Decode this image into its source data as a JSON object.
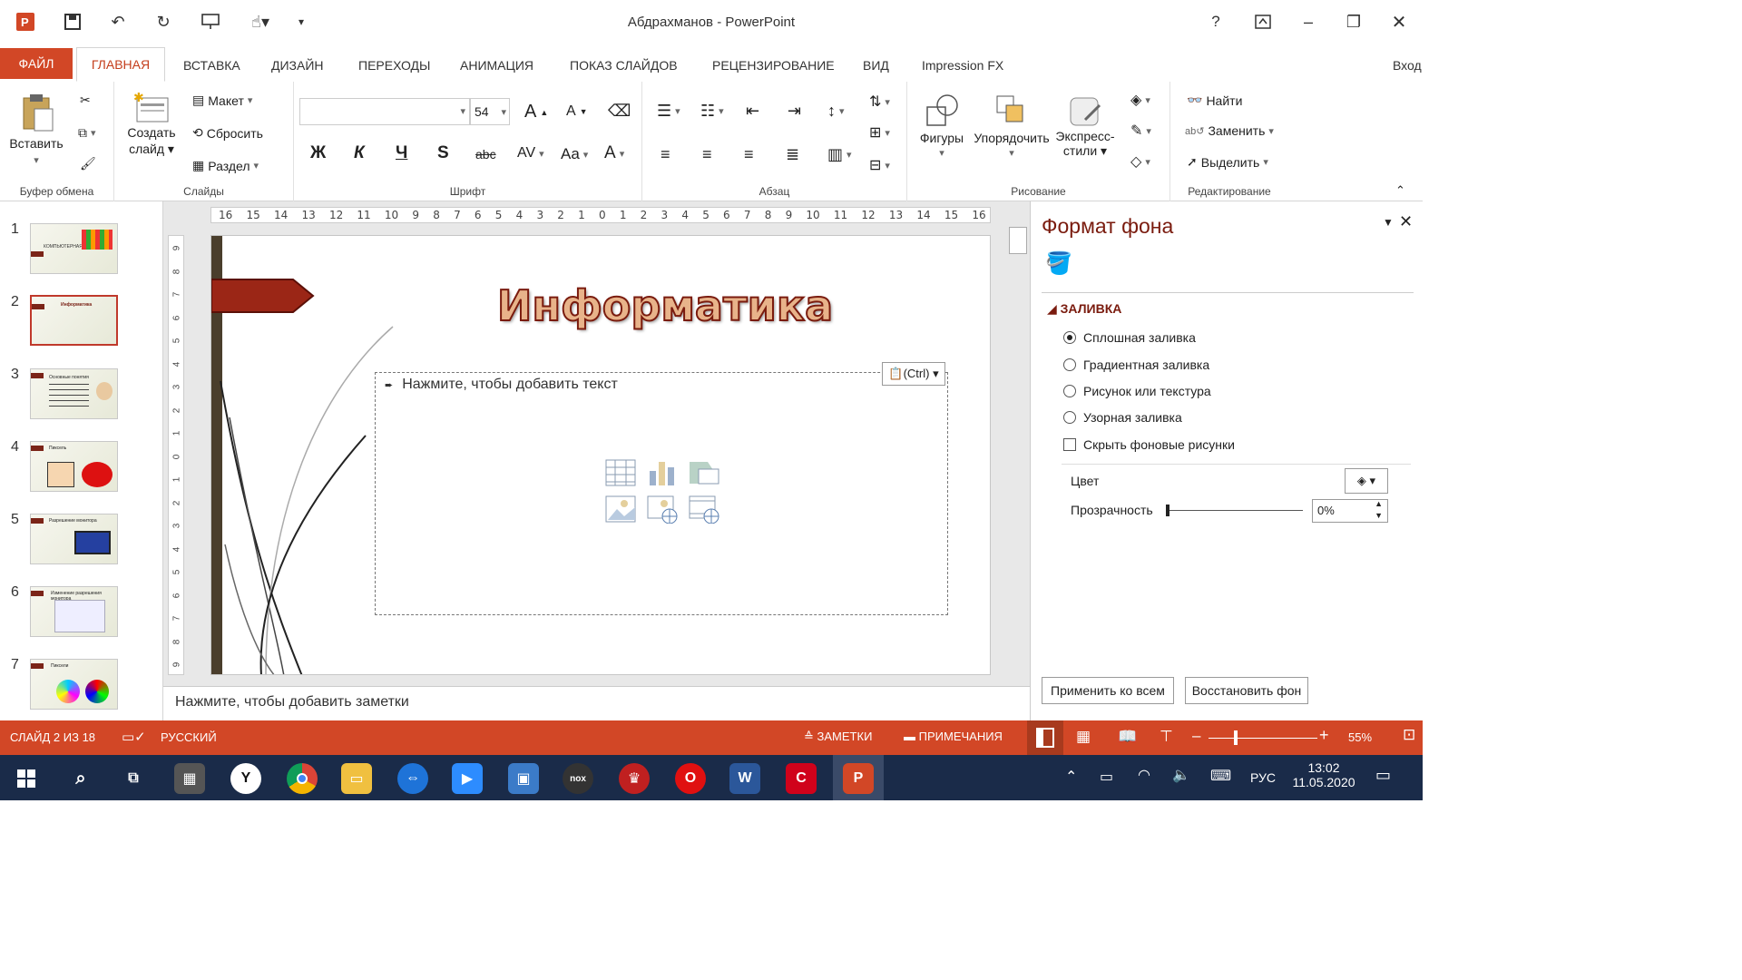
{
  "window": {
    "title": "Абдрахманов - PowerPoint",
    "help": "?",
    "sign_in": "Вход"
  },
  "tabs": {
    "file": "ФАЙЛ",
    "home": "ГЛАВНАЯ",
    "items": [
      "ВСТАВКА",
      "ДИЗАЙН",
      "ПЕРЕХОДЫ",
      "АНИМАЦИЯ",
      "ПОКАЗ СЛАЙДОВ",
      "РЕЦЕНЗИРОВАНИЕ",
      "ВИД",
      "Impression FX"
    ]
  },
  "ribbon": {
    "clipboard": {
      "paste": "Вставить",
      "label": "Буфер обмена"
    },
    "slides": {
      "new_slide": "Создать\nслайд",
      "new_slide_1": "Создать",
      "new_slide_2": "слайд",
      "layout": "Макет",
      "reset": "Сбросить",
      "section": "Раздел",
      "label": "Слайды"
    },
    "font": {
      "size": "54",
      "bold": "Ж",
      "italic": "К",
      "underline": "Ч",
      "shadow": "S",
      "strike": "abc",
      "spacing": "AV",
      "case": "Aa",
      "color": "A",
      "grow": "A",
      "shrink": "A",
      "label": "Шрифт"
    },
    "paragraph": {
      "label": "Абзац"
    },
    "drawing": {
      "shapes": "Фигуры",
      "arrange": "Упорядочить",
      "styles_1": "Экспресс-",
      "styles_2": "стили",
      "label": "Рисование"
    },
    "editing": {
      "find": "Найти",
      "replace": "Заменить",
      "select": "Выделить",
      "label": "Редактирование"
    }
  },
  "thumbnails": [
    {
      "num": "1",
      "caption": "КОМПЬЮТЕРНАЯ ГРАФИКА"
    },
    {
      "num": "2",
      "caption": "Информатика"
    },
    {
      "num": "3",
      "caption": "Основные понятия"
    },
    {
      "num": "4",
      "caption": "Пиксель"
    },
    {
      "num": "5",
      "caption": "Разрешение монитора"
    },
    {
      "num": "6",
      "caption": "Изменение разрешения монитора"
    },
    {
      "num": "7",
      "caption": "Пиксели"
    }
  ],
  "selected_slide": 2,
  "ruler": {
    "h": [
      "16",
      "15",
      "14",
      "13",
      "12",
      "11",
      "10",
      "9",
      "8",
      "7",
      "6",
      "5",
      "4",
      "3",
      "2",
      "1",
      "0",
      "1",
      "2",
      "3",
      "4",
      "5",
      "6",
      "7",
      "8",
      "9",
      "10",
      "11",
      "12",
      "13",
      "14",
      "15",
      "16"
    ],
    "v": [
      "9",
      "8",
      "7",
      "6",
      "5",
      "4",
      "3",
      "2",
      "1",
      "0",
      "1",
      "2",
      "3",
      "4",
      "5",
      "6",
      "7",
      "8",
      "9"
    ]
  },
  "slide": {
    "title": "Информатика",
    "placeholder": "Нажмите, чтобы добавить текст",
    "paste_options": "(Ctrl)",
    "title_color": "#8b1a10"
  },
  "notes_placeholder": "Нажмите, чтобы добавить заметки",
  "format_pane": {
    "title": "Формат фона",
    "section": "ЗАЛИВКА",
    "options": [
      "Сплошная заливка",
      "Градиентная заливка",
      "Рисунок или текстура",
      "Узорная заливка"
    ],
    "selected_option": 0,
    "hide_bg": "Скрыть фоновые рисунки",
    "color_label": "Цвет",
    "transparency_label": "Прозрачность",
    "transparency_value": "0%",
    "apply_all": "Применить ко всем",
    "reset_bg": "Восстановить фон"
  },
  "status": {
    "slide_info": "СЛАЙД 2 ИЗ 18",
    "language": "РУССКИЙ",
    "notes": "ЗАМЕТКИ",
    "comments": "ПРИМЕЧАНИЯ",
    "zoom": "55%"
  },
  "taskbar": {
    "lang": "РУС",
    "time": "13:02",
    "date": "11.05.2020"
  },
  "colors": {
    "accent": "#d24726",
    "taskbar": "#1a2b49"
  }
}
